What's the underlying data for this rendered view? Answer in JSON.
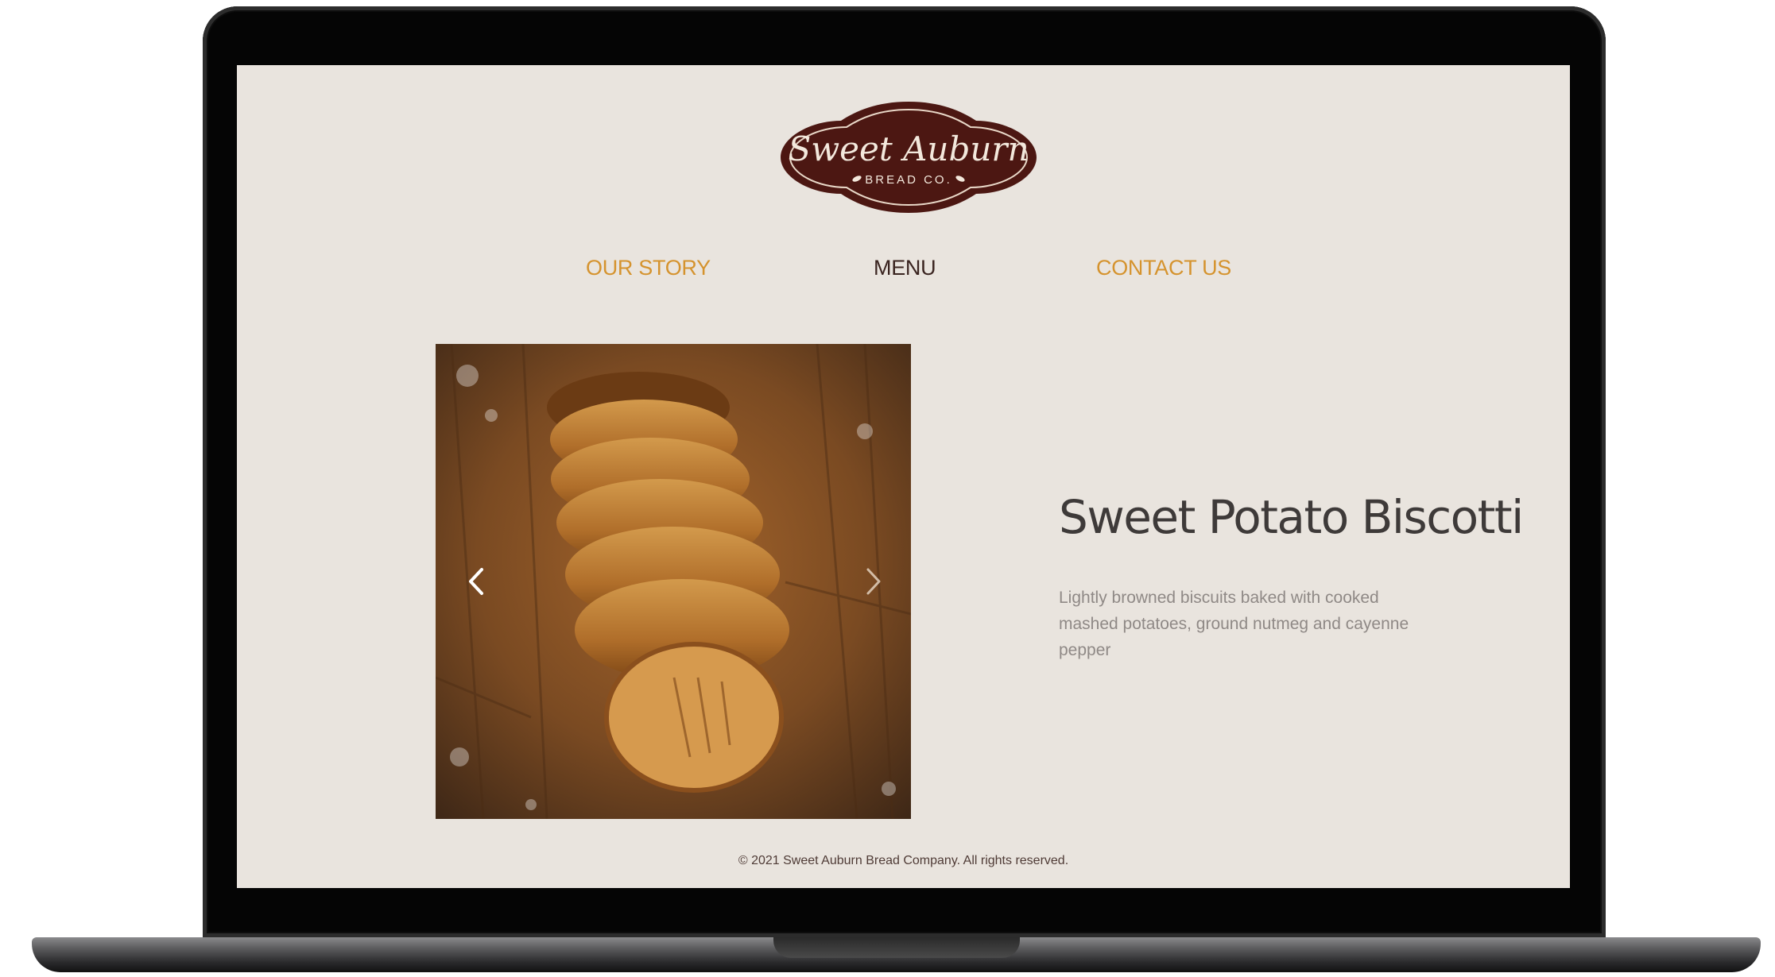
{
  "logo": {
    "script_text": "Sweet Auburn",
    "sub_text": "BREAD CO."
  },
  "nav": [
    {
      "label": "OUR STORY",
      "active": false
    },
    {
      "label": "MENU",
      "active": true
    },
    {
      "label": "CONTACT US",
      "active": false
    }
  ],
  "carousel": {
    "prev_icon": "chevron-left-icon",
    "next_icon": "chevron-right-icon",
    "image_subject": "sliced sweet potato biscotti on wooden board"
  },
  "product": {
    "title": "Sweet Potato Biscotti",
    "description": "Lightly browned biscuits baked with cooked mashed potatoes, ground nutmeg and cayenne pepper"
  },
  "footer": {
    "text": "© 2021 Sweet Auburn Bread Company. All rights reserved."
  },
  "colors": {
    "page_bg": "#e9e4de",
    "accent_gold": "#d5932e",
    "active_nav": "#3a2420",
    "logo_brown": "#4c1712",
    "title_text": "#3e3a39",
    "desc_text": "#8f8986"
  }
}
